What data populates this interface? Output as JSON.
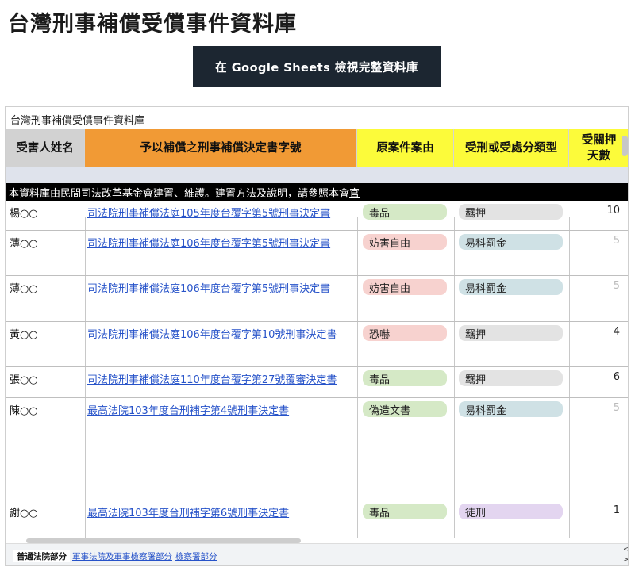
{
  "page": {
    "title": "台灣刑事補償受償事件資料庫",
    "sheets_button_label": "在 Google Sheets 檢視完整資料庫"
  },
  "sheet": {
    "title": "台灣刑事補償受償事件資料庫",
    "columns": [
      {
        "label": "受害人姓名",
        "color": "#d2d2d2"
      },
      {
        "label": "予以補償之刑事補償決定書字號",
        "color": "#f19a35"
      },
      {
        "label": "原案件案由",
        "color": "#fcfb3a"
      },
      {
        "label": "受刑或受處分類型",
        "color": "#fcfb3a"
      },
      {
        "label": "受關押\n天數",
        "color": "#fcfb3a"
      }
    ],
    "notice_text": "本資料庫由民間司法改革基金會建置、維護。建置方法及說明，請參照本會",
    "notice_link_text": "官",
    "rows": [
      {
        "name": "楊○○",
        "doc": "司法院刑事補償法庭105年度台覆字第5號刑事決定書",
        "case": "毒品",
        "type": "羈押",
        "days": "10"
      },
      {
        "name": "薄○○",
        "doc": "司法院刑事補償法庭106年度台覆字第5號刑事決定書",
        "case": "妨害自由",
        "type": "易科罰金",
        "days": "5"
      },
      {
        "name": "薄○○",
        "doc": "司法院刑事補償法庭106年度台覆字第5號刑事決定書",
        "case": "妨害自由",
        "type": "易科罰金",
        "days": "5"
      },
      {
        "name": "黃○○",
        "doc": "司法院刑事補償法庭106年度台覆字第10號刑事決定書",
        "case": "恐嚇",
        "type": "羈押",
        "days": "4"
      },
      {
        "name": "張○○",
        "doc": "司法院刑事補償法庭110年度台覆字第27號覆審決定書",
        "case": "毒品",
        "type": "羈押",
        "days": "6"
      },
      {
        "name": "陳○○",
        "doc": "最高法院103年度台刑補字第4號刑事決定書",
        "case": "偽造文書",
        "type": "易科罰金",
        "days": "5"
      },
      {
        "name": "謝○○",
        "doc": "最高法院103年度台刑補字第6號刑事決定書",
        "case": "毒品",
        "type": "徒刑",
        "days": "1"
      }
    ],
    "chip_colors": {
      "毒品": "#d5e9c6",
      "妨害自由": "#f7d2cf",
      "恐嚇": "#f7d2cf",
      "偽造文書": "#d5e9c6",
      "羈押": "#e3e3e3",
      "易科罰金": "#cfe1e5",
      "徒刑": "#e3d5f0"
    },
    "tabs": [
      {
        "label": "普通法院部分"
      },
      {
        "label": "軍事法院及軍事檢察署部分"
      },
      {
        "label": "檢察署部分"
      }
    ],
    "scroll_left_glyph": "<",
    "scroll_right_glyph": ">"
  }
}
